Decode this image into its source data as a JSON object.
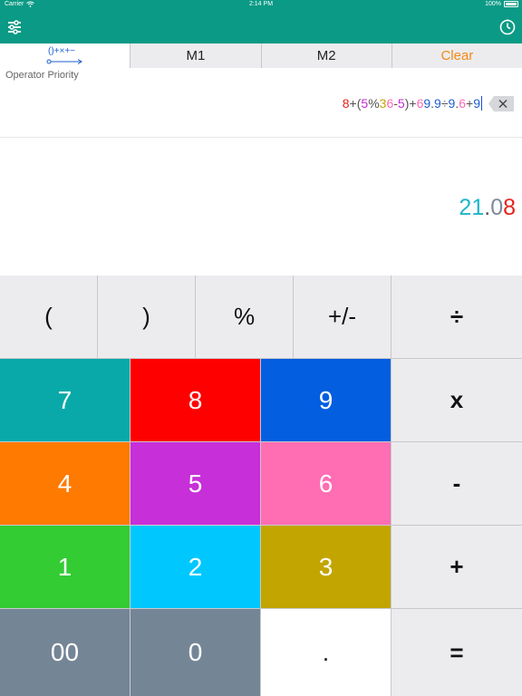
{
  "status_bar": {
    "carrier": "Carrier",
    "time": "2:14 PM",
    "battery": "100%"
  },
  "navbar": {
    "settings_icon": "sliders-icon",
    "history_icon": "clock-icon"
  },
  "tabs": [
    {
      "label": "",
      "icon": "operator-priority-icon"
    },
    {
      "label": "M1"
    },
    {
      "label": "M2"
    },
    {
      "label": "Clear"
    }
  ],
  "mode_label": "Operator Priority",
  "expression": {
    "text": "8+(5%36-5)+69.9÷9.6+9",
    "tokens": [
      {
        "t": "8",
        "color": "#e6231c"
      },
      {
        "t": "+",
        "color": "#555555"
      },
      {
        "t": "(",
        "color": "#555555"
      },
      {
        "t": "5",
        "color": "#c52bd6"
      },
      {
        "t": "%",
        "color": "#555555"
      },
      {
        "t": "3",
        "color": "#c4a400"
      },
      {
        "t": "6",
        "color": "#ff69b4"
      },
      {
        "t": "-",
        "color": "#555555"
      },
      {
        "t": "5",
        "color": "#c52bd6"
      },
      {
        "t": ")",
        "color": "#555555"
      },
      {
        "t": "+",
        "color": "#555555"
      },
      {
        "t": "6",
        "color": "#ff69b4"
      },
      {
        "t": "9",
        "color": "#1e5fd6"
      },
      {
        "t": ".",
        "color": "#555555"
      },
      {
        "t": "9",
        "color": "#1e5fd6"
      },
      {
        "t": "÷",
        "color": "#555555"
      },
      {
        "t": "9",
        "color": "#1e5fd6"
      },
      {
        "t": ".",
        "color": "#555555"
      },
      {
        "t": "6",
        "color": "#ff69b4"
      },
      {
        "t": "+",
        "color": "#555555"
      },
      {
        "t": "9",
        "color": "#1e5fd6"
      }
    ]
  },
  "result": {
    "text": "21.08",
    "tokens": [
      {
        "t": "2",
        "color": "#1fb5c9"
      },
      {
        "t": "1",
        "color": "#1fb5c9"
      },
      {
        "t": ".",
        "color": "#555555"
      },
      {
        "t": "0",
        "color": "#7c8a99"
      },
      {
        "t": "8",
        "color": "#e6231c"
      }
    ]
  },
  "keys": {
    "open_paren": "(",
    "close_paren": ")",
    "percent": "%",
    "plus_minus": "+/-",
    "divide": "÷",
    "multiply": "x",
    "subtract": "-",
    "add": "+",
    "equals": "=",
    "decimal": ".",
    "digits": [
      {
        "label": "7",
        "color": "#0aa9a9"
      },
      {
        "label": "8",
        "color": "#ff0000"
      },
      {
        "label": "9",
        "color": "#035ee0"
      },
      {
        "label": "4",
        "color": "#ff7a00"
      },
      {
        "label": "5",
        "color": "#c72fd8"
      },
      {
        "label": "6",
        "color": "#ff6db3"
      },
      {
        "label": "1",
        "color": "#33cc33"
      },
      {
        "label": "2",
        "color": "#00c8ff"
      },
      {
        "label": "3",
        "color": "#c2a500"
      },
      {
        "label": "00",
        "color": "#748596"
      },
      {
        "label": "0",
        "color": "#748596"
      }
    ]
  }
}
